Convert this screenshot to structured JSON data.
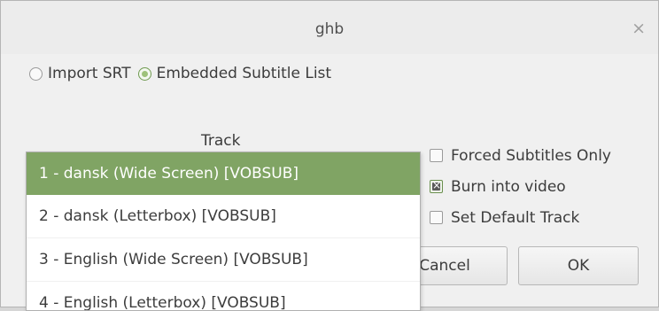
{
  "window": {
    "title": "ghb",
    "close_glyph": "×"
  },
  "source": {
    "options": [
      {
        "label": "Import SRT",
        "checked": false
      },
      {
        "label": "Embedded Subtitle List",
        "checked": true
      }
    ]
  },
  "track": {
    "label": "Track",
    "options": [
      {
        "label": "1 - dansk (Wide Screen) [VOBSUB]",
        "selected": true
      },
      {
        "label": "2 - dansk (Letterbox) [VOBSUB]",
        "selected": false
      },
      {
        "label": "3 - English (Wide Screen) [VOBSUB]",
        "selected": false
      },
      {
        "label": "4 - English (Letterbox) [VOBSUB]",
        "selected": false
      }
    ]
  },
  "checkboxes": [
    {
      "label": "Forced Subtitles Only",
      "checked": false
    },
    {
      "label": "Burn into video",
      "checked": true
    },
    {
      "label": "Set Default Track",
      "checked": false
    }
  ],
  "buttons": {
    "cancel": "Cancel",
    "ok": "OK"
  },
  "colors": {
    "accent": "#80a464",
    "selected_text": "#ffffff"
  }
}
